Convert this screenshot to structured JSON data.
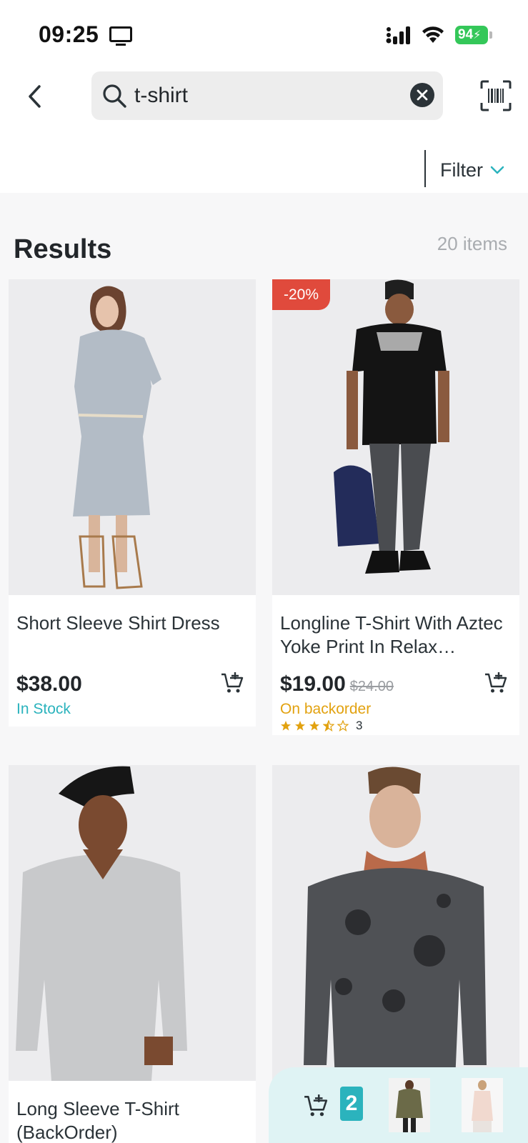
{
  "status_bar": {
    "time": "09:25",
    "battery": "94"
  },
  "search": {
    "query": "t-shirt"
  },
  "filter": {
    "label": "Filter"
  },
  "results": {
    "title": "Results",
    "count": "20 items"
  },
  "products": [
    {
      "name": "Short Sleeve Shirt Dress",
      "price": "$38.00",
      "stock": "In Stock"
    },
    {
      "badge": "-20%",
      "name": "Longline T-Shirt With Aztec Yoke Print In Relax…",
      "price": "$19.00",
      "old_price": "$24.00",
      "stock": "On backorder",
      "rating": 3.5,
      "review_count": "3"
    },
    {
      "name": "Long Sleeve T-Shirt (BackOrder)"
    },
    {
      "name": ""
    }
  ],
  "cart": {
    "count": "2"
  },
  "colors": {
    "accent_teal": "#2bb3bd",
    "badge_red": "#e04a3c",
    "backorder_orange": "#e2a210",
    "battery_green": "#34c759"
  }
}
